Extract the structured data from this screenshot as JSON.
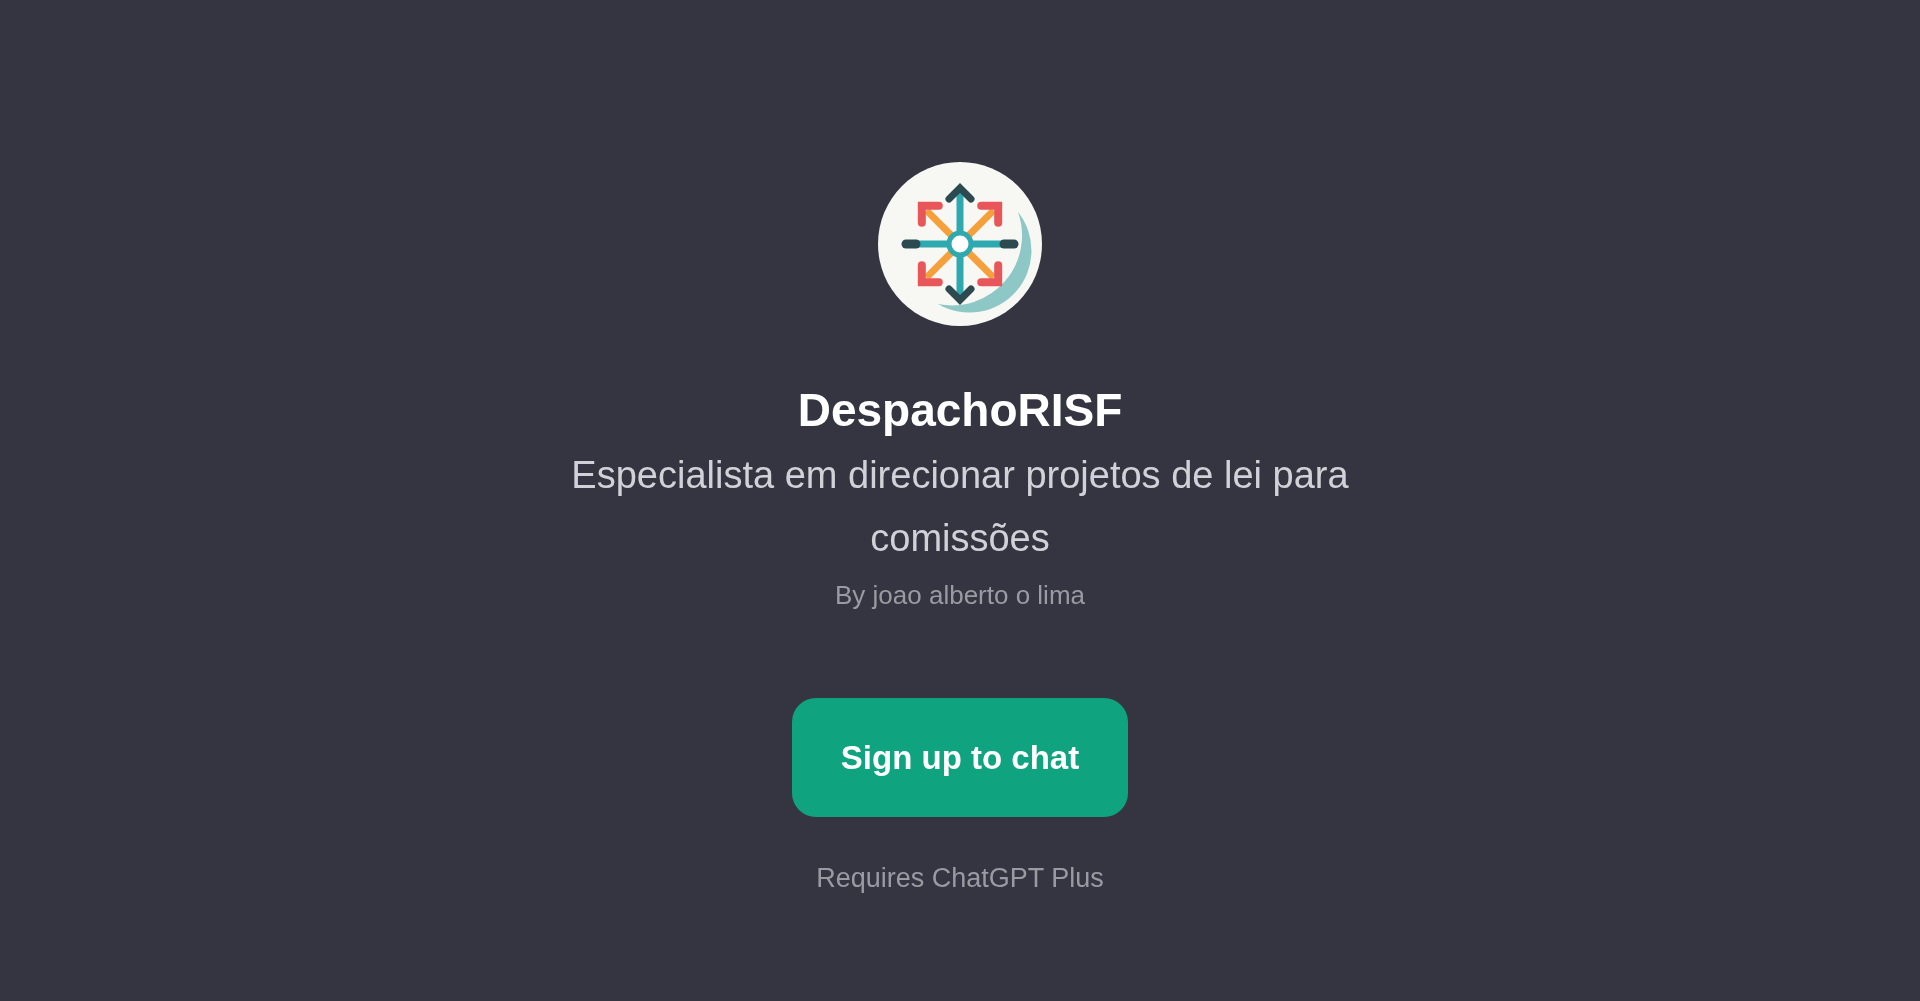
{
  "title": "DespachoRISF",
  "description": "Especialista em direcionar projetos de lei para comissões",
  "author": "By joao alberto o lima",
  "button": "Sign up to chat",
  "note": "Requires ChatGPT Plus"
}
